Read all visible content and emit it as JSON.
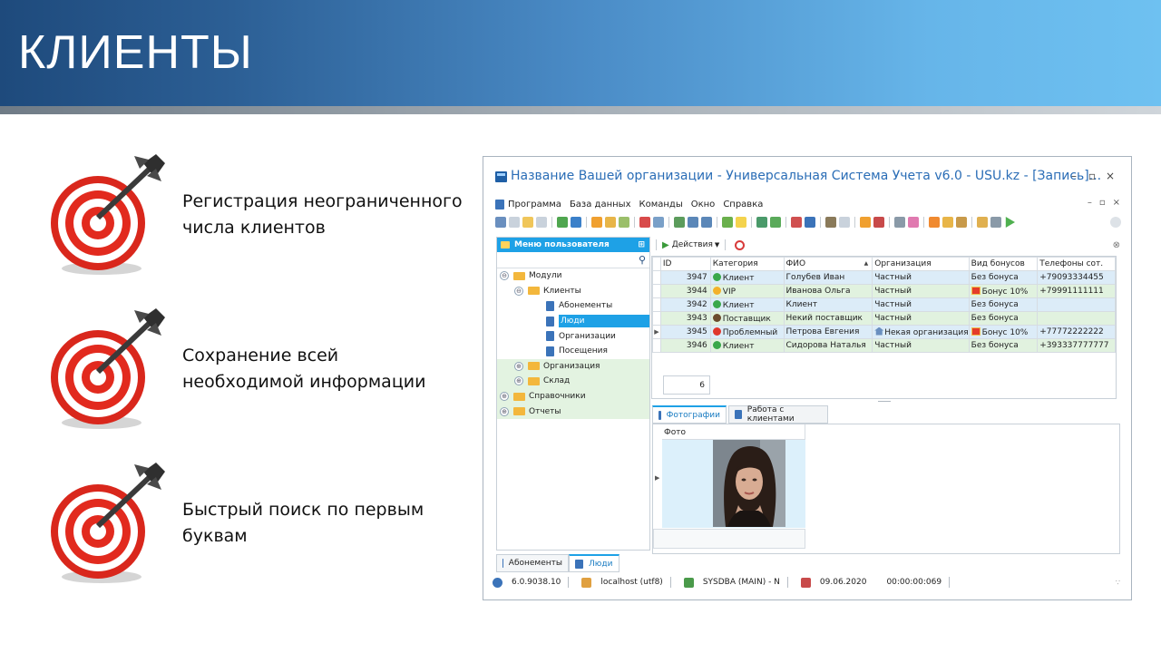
{
  "slide": {
    "title": "КЛИЕНТЫ",
    "bullets": [
      {
        "line1": "Регистрация неограниченного",
        "line2": "числа клиентов"
      },
      {
        "line1": "Сохранение всей",
        "line2": "необходимой информации"
      },
      {
        "line1": "Быстрый поиск по первым",
        "line2": "буквам"
      }
    ]
  },
  "app": {
    "window_title": "Название Вашей организации - Универсальная Система Учета v6.0 - USU.kz - [Запись]...",
    "window_controls": {
      "minimize": "–",
      "maximize": "▫",
      "close": "×"
    },
    "menu": [
      "Программа",
      "База данных",
      "Команды",
      "Окно",
      "Справка"
    ],
    "menu_right": {
      "minimize": "–",
      "restore": "▫",
      "close": "×"
    },
    "nav": {
      "header": "Меню пользователя",
      "pin": "⊞",
      "tree": [
        {
          "label": "Модули",
          "level": 0,
          "type": "folder",
          "expander": "⊖"
        },
        {
          "label": "Клиенты",
          "level": 1,
          "type": "folder",
          "expander": "⊖"
        },
        {
          "label": "Абонементы",
          "level": 2,
          "type": "doc"
        },
        {
          "label": "Люди",
          "level": 2,
          "type": "doc",
          "selected": true
        },
        {
          "label": "Организации",
          "level": 2,
          "type": "doc"
        },
        {
          "label": "Посещения",
          "level": 2,
          "type": "doc"
        },
        {
          "label": "Организация",
          "level": 1,
          "type": "folder",
          "expander": "⊕"
        },
        {
          "label": "Склад",
          "level": 1,
          "type": "folder",
          "expander": "⊕"
        },
        {
          "label": "Справочники",
          "level": 0,
          "type": "folder",
          "expander": "⊕"
        },
        {
          "label": "Отчеты",
          "level": 0,
          "type": "folder",
          "expander": "⊕"
        }
      ]
    },
    "bottom_tabs": [
      "Абонементы",
      "Люди"
    ],
    "actions_label": "Действия",
    "table": {
      "columns": [
        "ID",
        "Категория",
        "ФИО",
        "Организация",
        "Вид бонусов",
        "Телефоны сот."
      ],
      "rows": [
        {
          "id": "3947",
          "category": "Клиент",
          "cat_color": "#3aa84a",
          "name": "Голубев Иван",
          "org": "Частный",
          "org_home": false,
          "bonus": "Без бонуса",
          "bonus_gift": false,
          "phone": "+79093334455"
        },
        {
          "id": "3944",
          "category": "VIP",
          "cat_color": "#f3b12a",
          "name": "Иванова Ольга",
          "org": "Частный",
          "org_home": false,
          "bonus": "Бонус 10%",
          "bonus_gift": true,
          "phone": "+79991111111"
        },
        {
          "id": "3942",
          "category": "Клиент",
          "cat_color": "#3aa84a",
          "name": "Клиент",
          "org": "Частный",
          "org_home": false,
          "bonus": "Без бонуса",
          "bonus_gift": false,
          "phone": ""
        },
        {
          "id": "3943",
          "category": "Поставщик",
          "cat_color": "#6b4a2e",
          "name": "Некий поставщик",
          "org": "Частный",
          "org_home": false,
          "bonus": "Без бонуса",
          "bonus_gift": false,
          "phone": ""
        },
        {
          "id": "3945",
          "category": "Проблемный",
          "cat_color": "#e0362c",
          "name": "Петрова Евгения",
          "org": "Некая организация",
          "org_home": true,
          "bonus": "Бонус 10%",
          "bonus_gift": true,
          "phone": "+77772222222",
          "current": true
        },
        {
          "id": "3946",
          "category": "Клиент",
          "cat_color": "#3aa84a",
          "name": "Сидорова Наталья",
          "org": "Частный",
          "org_home": false,
          "bonus": "Без бонуса",
          "bonus_gift": false,
          "phone": "+393337777777"
        }
      ],
      "sorted_column_indicator": "▲",
      "row_count": "6"
    },
    "detail_tabs": [
      "Фотографии",
      "Работа с клиентами"
    ],
    "photo_column": "Фото",
    "status": {
      "version": "6.0.9038.10",
      "db": "localhost (utf8)",
      "user": "SYSDBA (MAIN) - N",
      "date": "09.06.2020",
      "timer": "00:00:00:069"
    }
  },
  "colors": {
    "accent": "#1ea1e6",
    "row_blue": "#dcecf8",
    "row_green": "#e1f2df",
    "target_red": "#e22a1e"
  }
}
